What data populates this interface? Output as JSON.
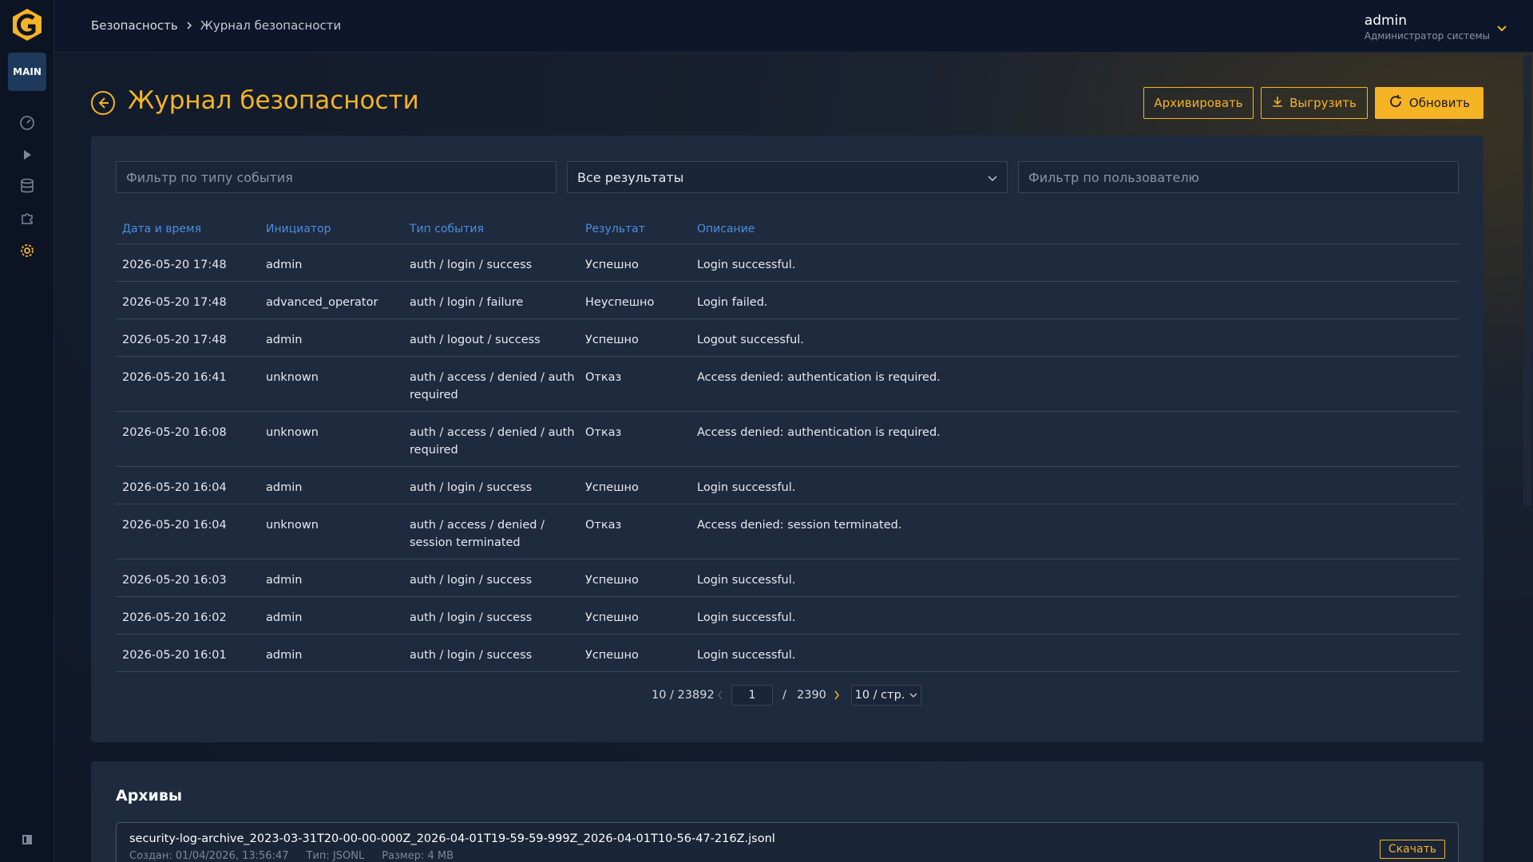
{
  "nav": {
    "main_label": "MAIN",
    "items": [
      "dashboard-icon",
      "play-icon",
      "database-icon",
      "puzzle-icon",
      "gear-icon"
    ]
  },
  "breadcrumb": {
    "parent": "Безопасность",
    "current": "Журнал безопасности"
  },
  "user": {
    "name": "admin",
    "role": "Администратор системы"
  },
  "page": {
    "title": "Журнал безопасности"
  },
  "actions": {
    "archive": "Архивировать",
    "export": "Выгрузить",
    "refresh": "Обновить"
  },
  "filters": {
    "event_type_placeholder": "Фильтр по типу события",
    "result_value": "Все результаты",
    "user_placeholder": "Фильтр по пользователю"
  },
  "table": {
    "headers": [
      "Дата и время",
      "Инициатор",
      "Тип события",
      "Результат",
      "Описание"
    ],
    "rows": [
      [
        "2026-05-20 17:48",
        "admin",
        "auth / login / success",
        "Успешно",
        "Login successful."
      ],
      [
        "2026-05-20 17:48",
        "advanced_operator",
        "auth / login / failure",
        "Неуспешно",
        "Login failed."
      ],
      [
        "2026-05-20 17:48",
        "admin",
        "auth / logout / success",
        "Успешно",
        "Logout successful."
      ],
      [
        "2026-05-20 16:41",
        "unknown",
        "auth / access / denied / auth required",
        "Отказ",
        "Access denied: authentication is required."
      ],
      [
        "2026-05-20 16:08",
        "unknown",
        "auth / access / denied / auth required",
        "Отказ",
        "Access denied: authentication is required."
      ],
      [
        "2026-05-20 16:04",
        "admin",
        "auth / login / success",
        "Успешно",
        "Login successful."
      ],
      [
        "2026-05-20 16:04",
        "unknown",
        "auth / access / denied / session terminated",
        "Отказ",
        "Access denied: session terminated."
      ],
      [
        "2026-05-20 16:03",
        "admin",
        "auth / login / success",
        "Успешно",
        "Login successful."
      ],
      [
        "2026-05-20 16:02",
        "admin",
        "auth / login / success",
        "Успешно",
        "Login successful."
      ],
      [
        "2026-05-20 16:01",
        "admin",
        "auth / login / success",
        "Успешно",
        "Login successful."
      ]
    ]
  },
  "pagination": {
    "range": "10 / 23892",
    "current_page": "1",
    "separator": "/",
    "total_pages": "2390",
    "page_size": "10 / стр."
  },
  "archives": {
    "title": "Архивы",
    "items": [
      {
        "name": "security-log-archive_2023-03-31T20-00-00-000Z_2026-04-01T19-59-59-999Z_2026-04-01T10-56-47-216Z.jsonl",
        "created": "Создан: 01/04/2026, 13:56:47",
        "type": "Тип: JSONL",
        "size": "Размер: 4 MB",
        "download_label": "Скачать"
      }
    ]
  },
  "colors": {
    "accent": "#f5b326",
    "link": "#4a8fe0",
    "panel": "#1e2a3e"
  }
}
